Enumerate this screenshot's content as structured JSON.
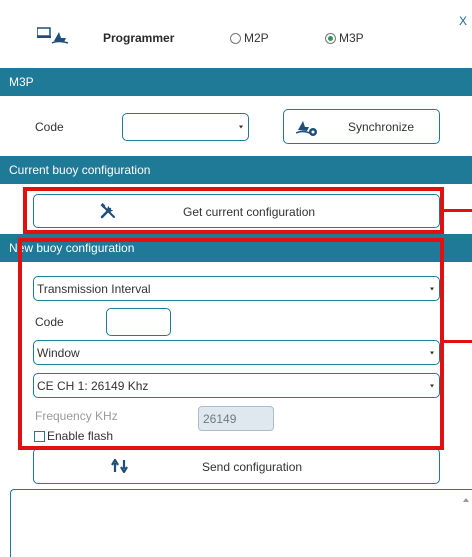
{
  "window": {
    "close_label": "X"
  },
  "header": {
    "programmer_label": "Programmer",
    "mode_options": [
      {
        "label": "M2P",
        "selected": false
      },
      {
        "label": "M3P",
        "selected": true
      }
    ]
  },
  "m3p_section": {
    "title": "M3P",
    "code_label": "Code",
    "code_select_value": "",
    "synchronize_label": "Synchronize"
  },
  "current_config": {
    "title": "Current buoy configuration",
    "get_button_label": "Get current configuration"
  },
  "new_config": {
    "title": "New buoy configuration",
    "interval_select_value": "Transmission Interval",
    "code_label": "Code",
    "code_value": "",
    "window_select_value": "Window",
    "channel_select_value": "CE CH 1: 26149 Khz",
    "frequency_label": "Frequency KHz",
    "frequency_value": "26149",
    "enable_flash_label": "Enable flash",
    "enable_flash_checked": false,
    "send_button_label": "Send configuration"
  },
  "colors": {
    "accent": "#1e7a96",
    "highlight": "#e21111",
    "radio_selected": "#2a9a55"
  },
  "icons": [
    "device-icon",
    "synchronize-icon",
    "tools-icon",
    "transfer-arrows-icon",
    "chevron-down-icon",
    "scroll-up-icon"
  ]
}
